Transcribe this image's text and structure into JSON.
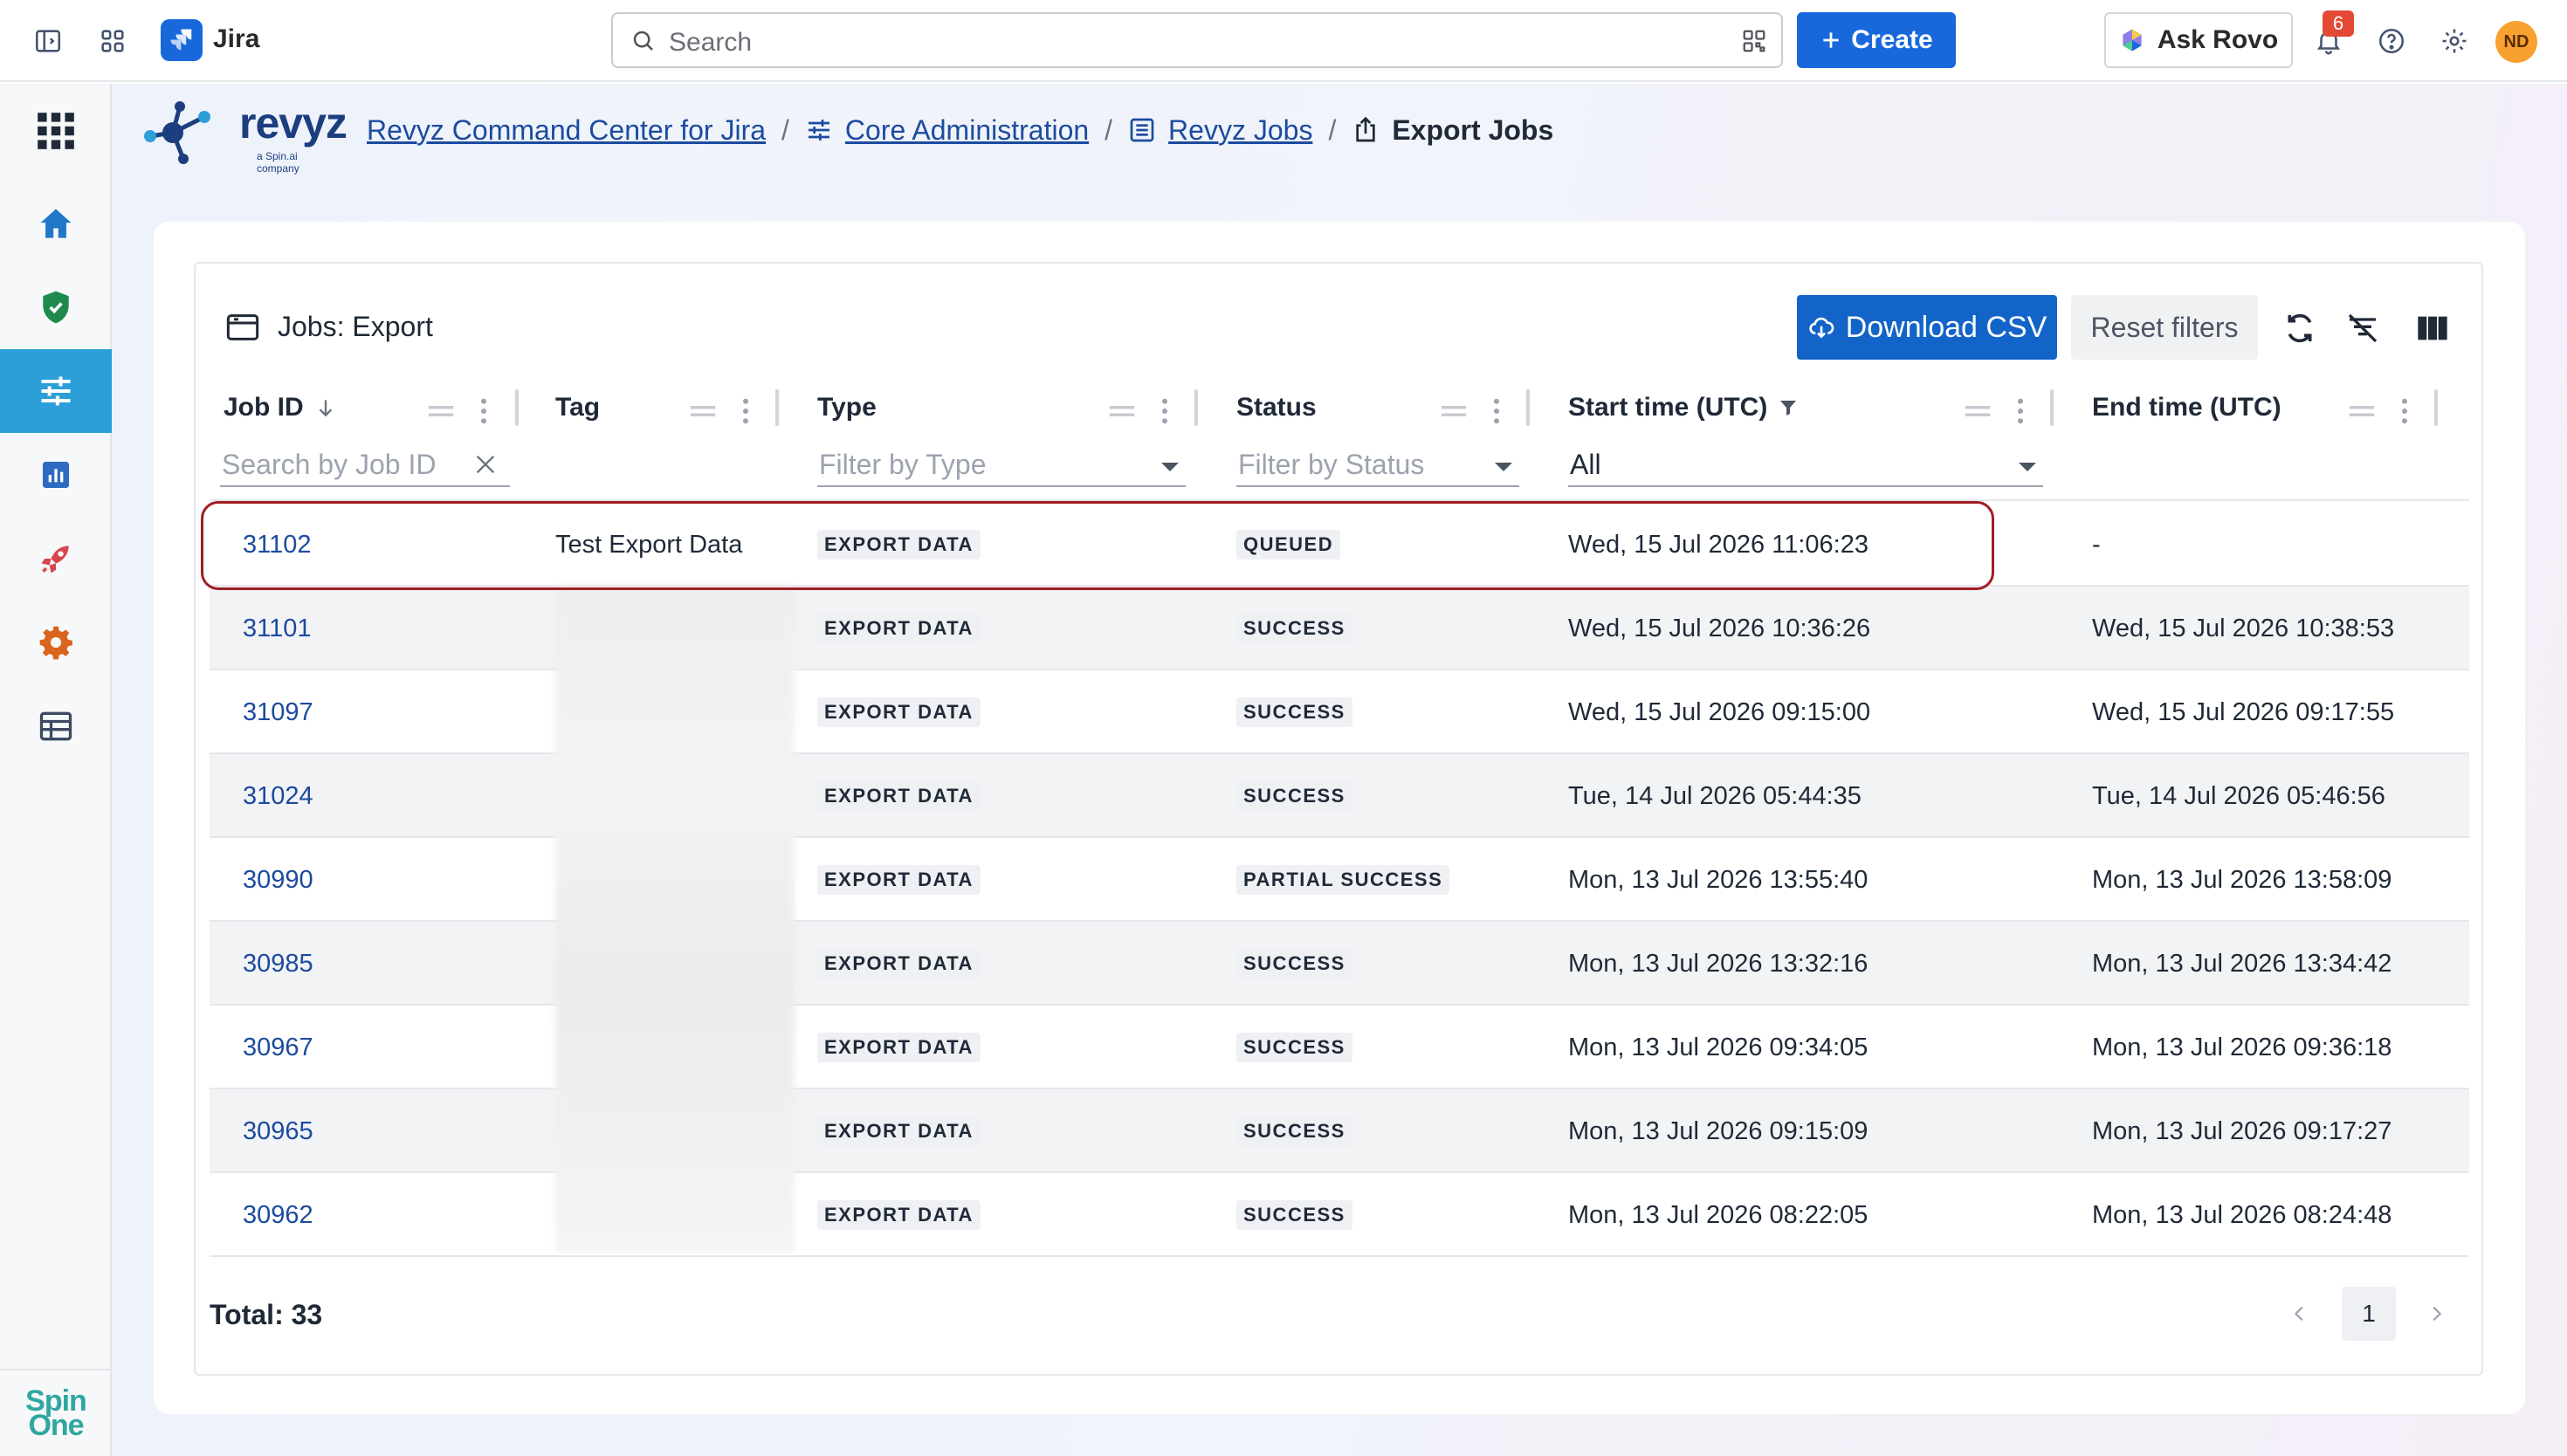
{
  "topbar": {
    "app_name": "Jira",
    "search_placeholder": "Search",
    "create_label": "Create",
    "ask_rovo_label": "Ask Rovo",
    "notification_count": "6",
    "avatar_initials": "ND"
  },
  "brand": {
    "name": "revyz",
    "tagline": "a Spin.ai company",
    "footer_logo_line1": "Spin",
    "footer_logo_line2": "One"
  },
  "sidebar": {
    "items": [
      {
        "icon": "home-icon",
        "active": false
      },
      {
        "icon": "shield-check-icon",
        "active": false
      },
      {
        "icon": "sliders-icon",
        "active": true
      },
      {
        "icon": "bar-chart-icon",
        "active": false
      },
      {
        "icon": "rocket-icon",
        "active": false
      },
      {
        "icon": "gear-icon",
        "active": false
      },
      {
        "icon": "table-icon",
        "active": false
      }
    ]
  },
  "breadcrumb": {
    "items": [
      {
        "label": "Revyz Command Center for Jira",
        "link": true
      },
      {
        "label": "Core Administration",
        "link": true
      },
      {
        "label": "Revyz Jobs",
        "link": true
      }
    ],
    "current": "Export Jobs"
  },
  "card": {
    "title": "Jobs: Export",
    "download_label": "Download CSV",
    "reset_label": "Reset filters"
  },
  "table": {
    "columns": {
      "job_id": "Job ID",
      "tag": "Tag",
      "type": "Type",
      "status": "Status",
      "start_time": "Start time (UTC)",
      "end_time": "End time (UTC)"
    },
    "filters": {
      "job_id_placeholder": "Search by Job ID",
      "type_placeholder": "Filter by Type",
      "status_placeholder": "Filter by Status",
      "start_time_value": "All"
    },
    "rows": [
      {
        "id": "31102",
        "tag": "Test Export Data",
        "type": "EXPORT DATA",
        "status": "QUEUED",
        "start": "Wed, 15 Jul 2026 11:06:23",
        "end": "-"
      },
      {
        "id": "31101",
        "tag": "",
        "type": "EXPORT DATA",
        "status": "SUCCESS",
        "start": "Wed, 15 Jul 2026 10:36:26",
        "end": "Wed, 15 Jul 2026 10:38:53"
      },
      {
        "id": "31097",
        "tag": "",
        "type": "EXPORT DATA",
        "status": "SUCCESS",
        "start": "Wed, 15 Jul 2026 09:15:00",
        "end": "Wed, 15 Jul 2026 09:17:55"
      },
      {
        "id": "31024",
        "tag": "",
        "type": "EXPORT DATA",
        "status": "SUCCESS",
        "start": "Tue, 14 Jul 2026 05:44:35",
        "end": "Tue, 14 Jul 2026 05:46:56"
      },
      {
        "id": "30990",
        "tag": "",
        "type": "EXPORT DATA",
        "status": "PARTIAL SUCCESS",
        "start": "Mon, 13 Jul 2026 13:55:40",
        "end": "Mon, 13 Jul 2026 13:58:09"
      },
      {
        "id": "30985",
        "tag": "",
        "type": "EXPORT DATA",
        "status": "SUCCESS",
        "start": "Mon, 13 Jul 2026 13:32:16",
        "end": "Mon, 13 Jul 2026 13:34:42"
      },
      {
        "id": "30967",
        "tag": "",
        "type": "EXPORT DATA",
        "status": "SUCCESS",
        "start": "Mon, 13 Jul 2026 09:34:05",
        "end": "Mon, 13 Jul 2026 09:36:18"
      },
      {
        "id": "30965",
        "tag": "",
        "type": "EXPORT DATA",
        "status": "SUCCESS",
        "start": "Mon, 13 Jul 2026 09:15:09",
        "end": "Mon, 13 Jul 2026 09:17:27"
      },
      {
        "id": "30962",
        "tag": "",
        "type": "EXPORT DATA",
        "status": "SUCCESS",
        "start": "Mon, 13 Jul 2026 08:22:05",
        "end": "Mon, 13 Jul 2026 08:24:48"
      }
    ]
  },
  "footer": {
    "total_label": "Total: 33",
    "current_page": "1"
  },
  "colors": {
    "primary": "#1868db",
    "revyz_blue": "#1c3e7f",
    "active_nav": "#2d9fd8",
    "highlight_border": "#a01e23"
  }
}
